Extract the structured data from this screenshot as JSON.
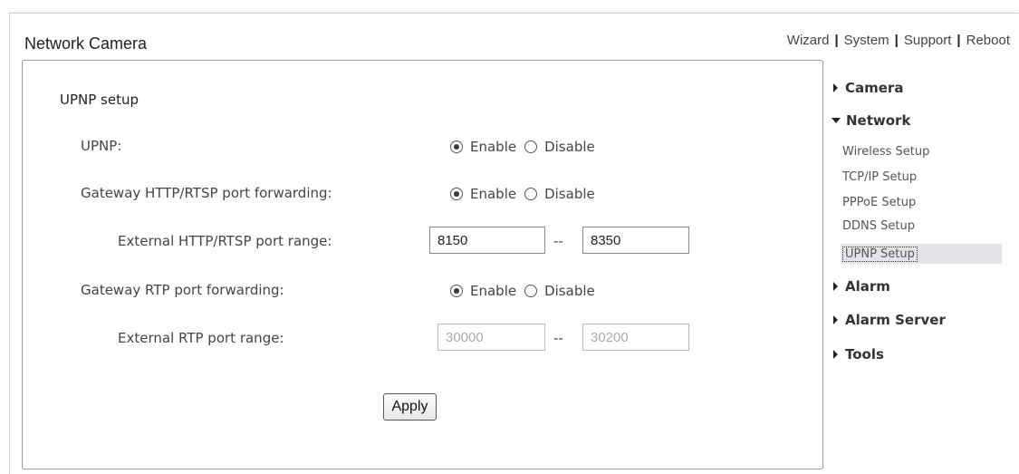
{
  "header": {
    "app_title": "Network Camera",
    "nav": [
      "Wizard",
      "System",
      "Support",
      "Reboot"
    ],
    "separator": "|"
  },
  "form": {
    "section_title": "UPNP setup",
    "upnp": {
      "label": "UPNP:",
      "enable": "Enable",
      "disable": "Disable",
      "selected": "Enable"
    },
    "http_forwarding": {
      "label": "Gateway HTTP/RTSP port forwarding:",
      "enable": "Enable",
      "disable": "Disable",
      "selected": "Enable"
    },
    "http_range": {
      "label": "External HTTP/RTSP port range:",
      "from": "8150",
      "separator": "--",
      "to": "8350"
    },
    "rtp_forwarding": {
      "label": "Gateway RTP port forwarding:",
      "enable": "Enable",
      "disable": "Disable",
      "selected": "Enable"
    },
    "rtp_range": {
      "label": "External RTP port range:",
      "from": "30000",
      "separator": "--",
      "to": "30200",
      "disabled": true
    },
    "apply_label": "Apply"
  },
  "sidebar": {
    "camera": "Camera",
    "network": "Network",
    "network_items": [
      "Wireless Setup",
      "TCP/IP Setup",
      "PPPoE Setup",
      "DDNS Setup",
      "UPNP Setup"
    ],
    "active_item": "UPNP Setup",
    "alarm": "Alarm",
    "alarm_server": "Alarm Server",
    "tools": "Tools"
  }
}
